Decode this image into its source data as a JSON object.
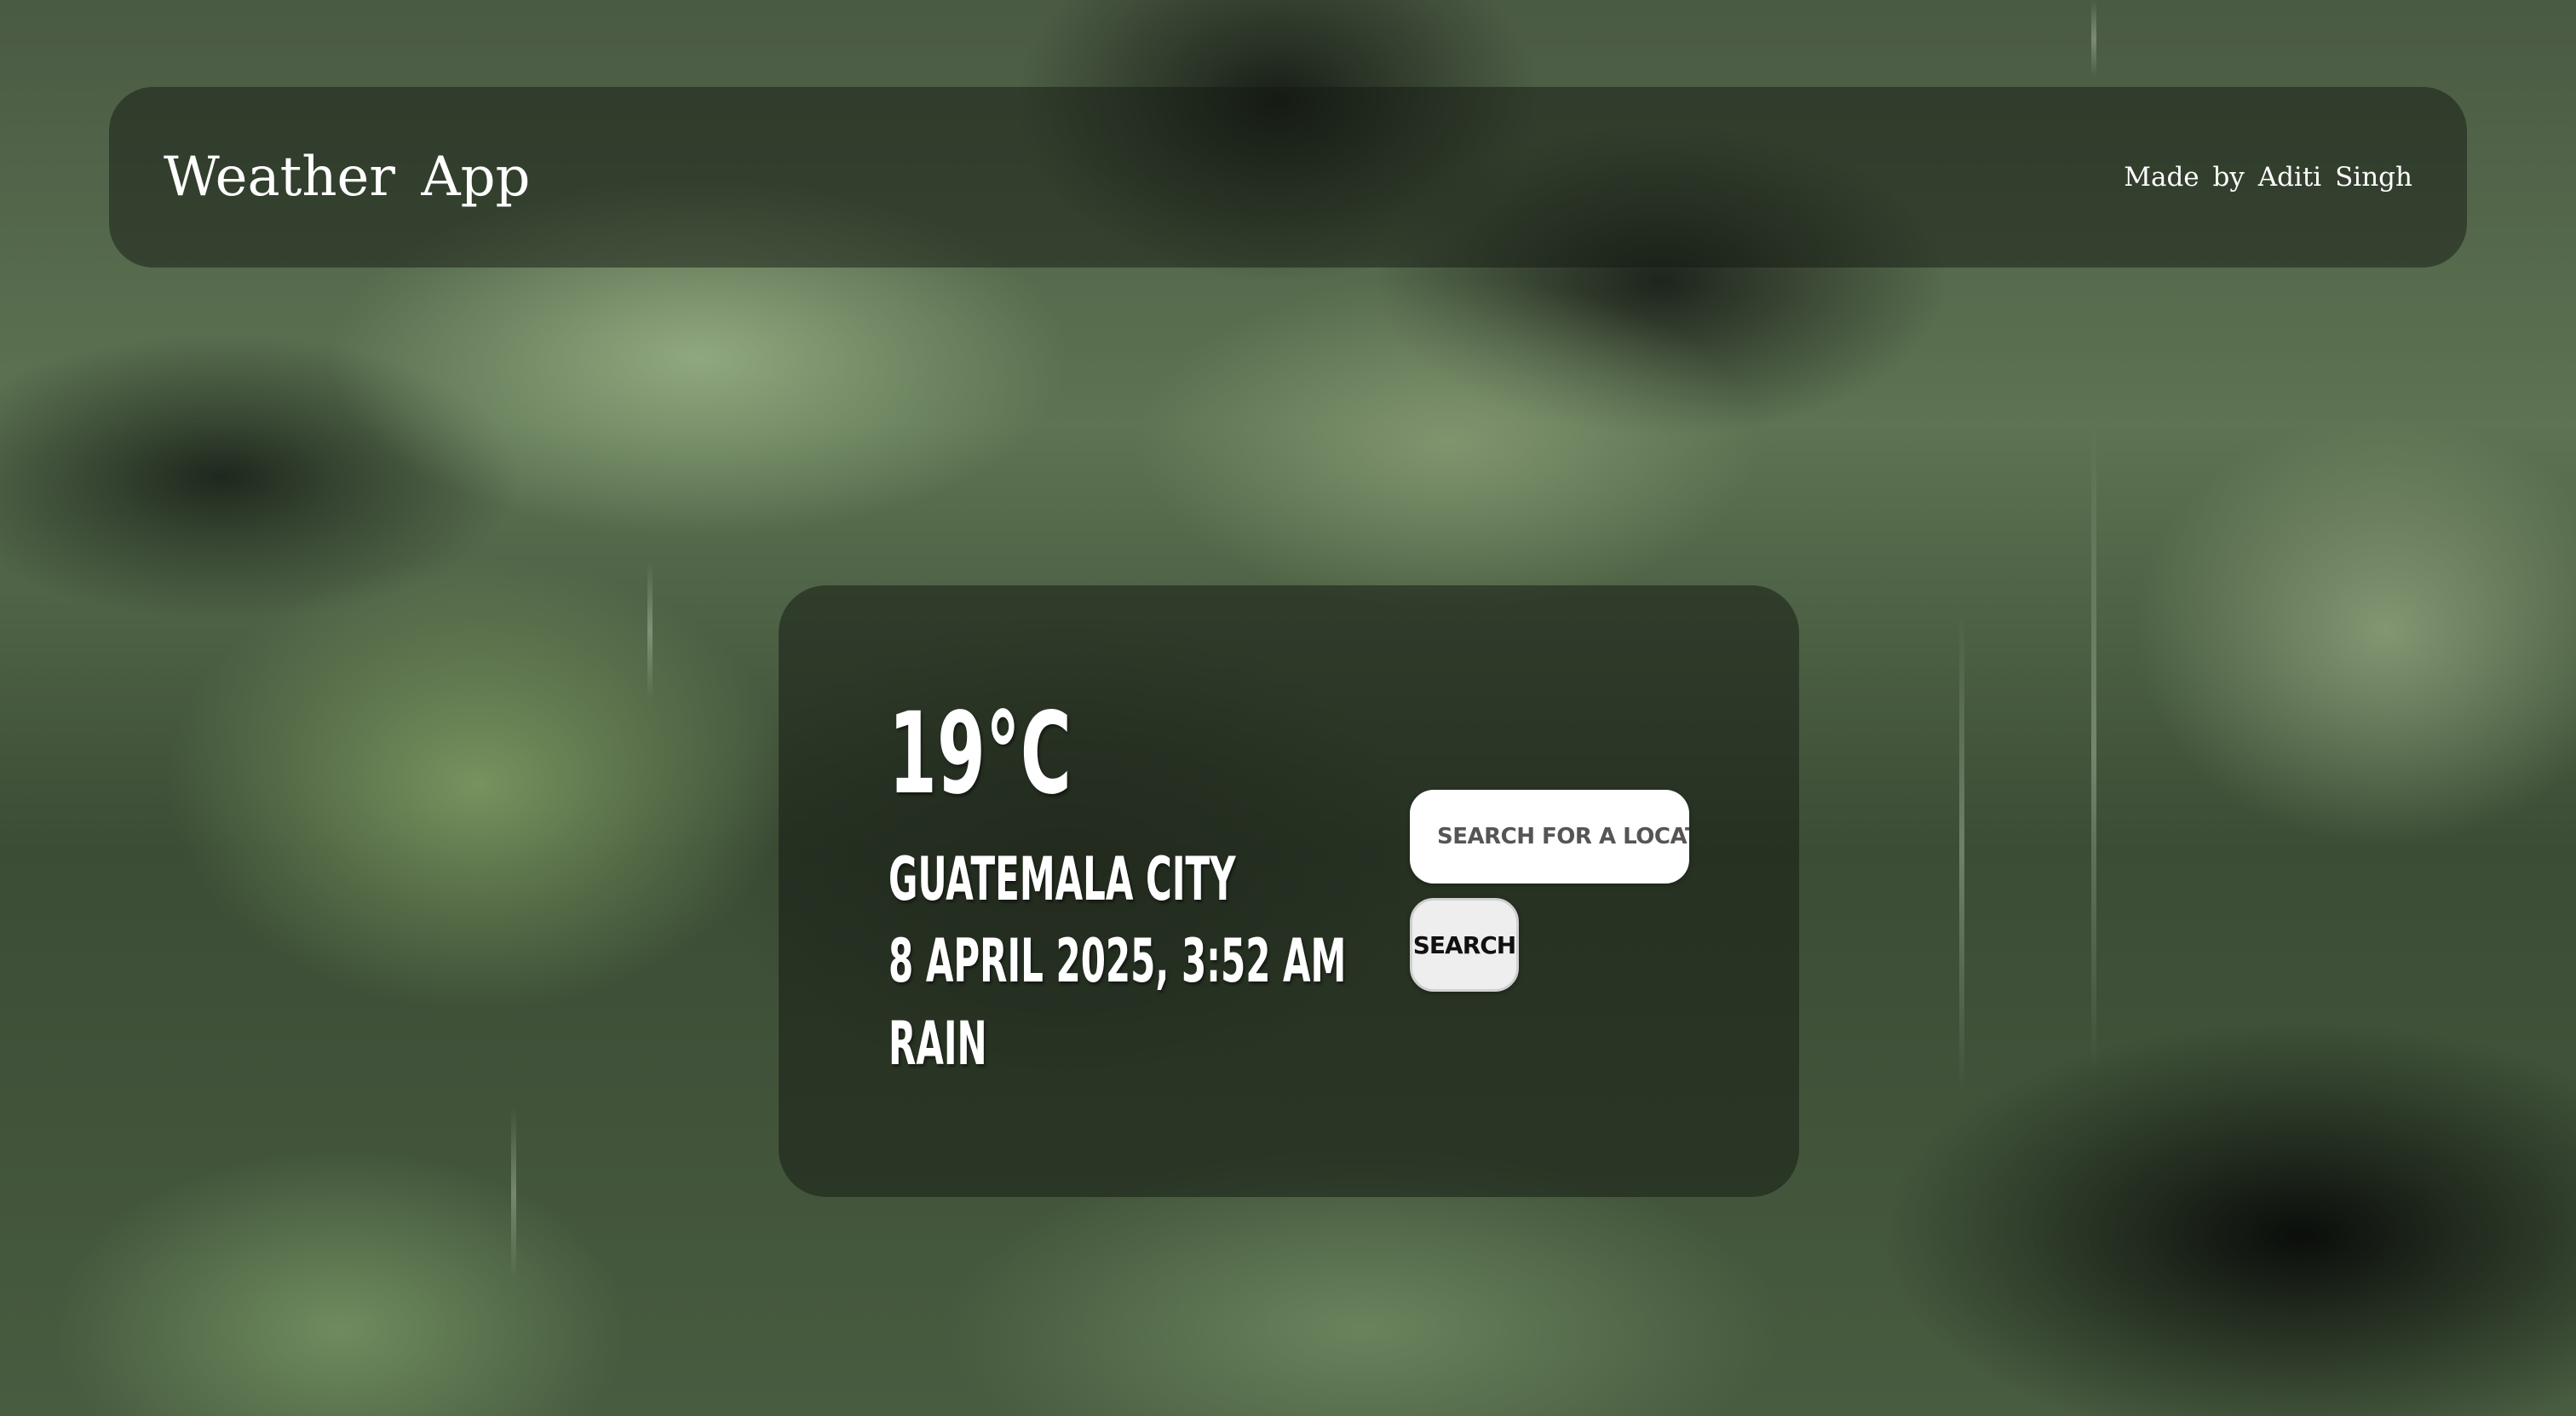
{
  "header": {
    "app_title": "Weather App",
    "credit": "Made by Aditi Singh"
  },
  "weather": {
    "temperature": "19°C",
    "city": "Guatemala City",
    "datetime": "8 April 2025, 3:52 AM",
    "condition": "Rain"
  },
  "search": {
    "placeholder": "Search for a location",
    "button_label": "Search"
  }
}
